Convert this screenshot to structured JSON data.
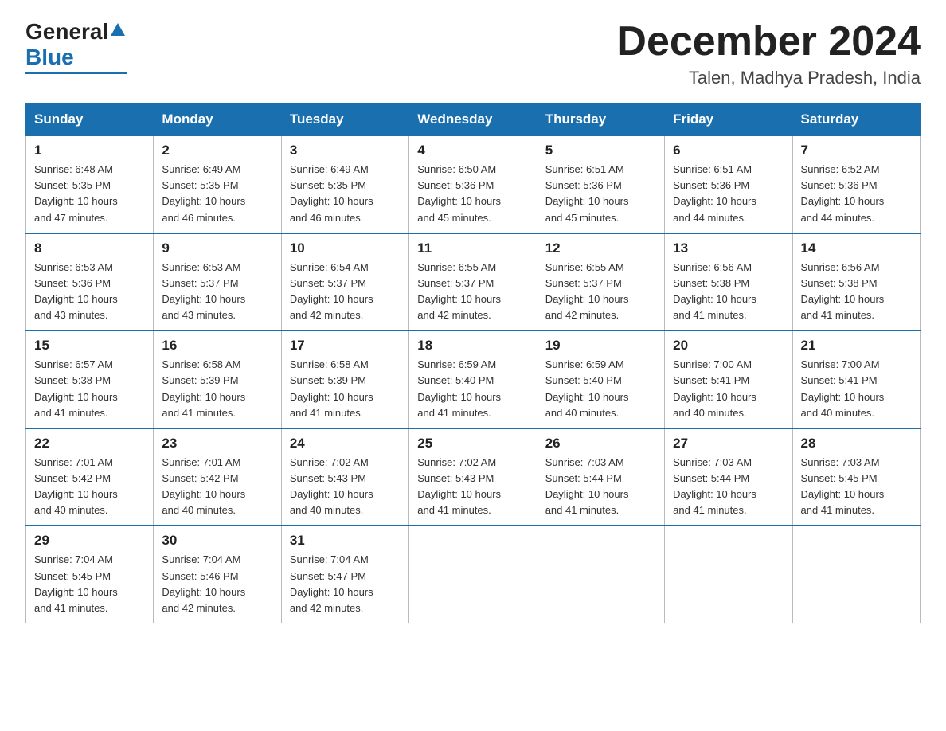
{
  "logo": {
    "general": "General",
    "blue": "Blue"
  },
  "header": {
    "title": "December 2024",
    "subtitle": "Talen, Madhya Pradesh, India"
  },
  "weekdays": [
    "Sunday",
    "Monday",
    "Tuesday",
    "Wednesday",
    "Thursday",
    "Friday",
    "Saturday"
  ],
  "weeks": [
    [
      {
        "day": "1",
        "sunrise": "6:48 AM",
        "sunset": "5:35 PM",
        "daylight": "10 hours and 47 minutes."
      },
      {
        "day": "2",
        "sunrise": "6:49 AM",
        "sunset": "5:35 PM",
        "daylight": "10 hours and 46 minutes."
      },
      {
        "day": "3",
        "sunrise": "6:49 AM",
        "sunset": "5:35 PM",
        "daylight": "10 hours and 46 minutes."
      },
      {
        "day": "4",
        "sunrise": "6:50 AM",
        "sunset": "5:36 PM",
        "daylight": "10 hours and 45 minutes."
      },
      {
        "day": "5",
        "sunrise": "6:51 AM",
        "sunset": "5:36 PM",
        "daylight": "10 hours and 45 minutes."
      },
      {
        "day": "6",
        "sunrise": "6:51 AM",
        "sunset": "5:36 PM",
        "daylight": "10 hours and 44 minutes."
      },
      {
        "day": "7",
        "sunrise": "6:52 AM",
        "sunset": "5:36 PM",
        "daylight": "10 hours and 44 minutes."
      }
    ],
    [
      {
        "day": "8",
        "sunrise": "6:53 AM",
        "sunset": "5:36 PM",
        "daylight": "10 hours and 43 minutes."
      },
      {
        "day": "9",
        "sunrise": "6:53 AM",
        "sunset": "5:37 PM",
        "daylight": "10 hours and 43 minutes."
      },
      {
        "day": "10",
        "sunrise": "6:54 AM",
        "sunset": "5:37 PM",
        "daylight": "10 hours and 42 minutes."
      },
      {
        "day": "11",
        "sunrise": "6:55 AM",
        "sunset": "5:37 PM",
        "daylight": "10 hours and 42 minutes."
      },
      {
        "day": "12",
        "sunrise": "6:55 AM",
        "sunset": "5:37 PM",
        "daylight": "10 hours and 42 minutes."
      },
      {
        "day": "13",
        "sunrise": "6:56 AM",
        "sunset": "5:38 PM",
        "daylight": "10 hours and 41 minutes."
      },
      {
        "day": "14",
        "sunrise": "6:56 AM",
        "sunset": "5:38 PM",
        "daylight": "10 hours and 41 minutes."
      }
    ],
    [
      {
        "day": "15",
        "sunrise": "6:57 AM",
        "sunset": "5:38 PM",
        "daylight": "10 hours and 41 minutes."
      },
      {
        "day": "16",
        "sunrise": "6:58 AM",
        "sunset": "5:39 PM",
        "daylight": "10 hours and 41 minutes."
      },
      {
        "day": "17",
        "sunrise": "6:58 AM",
        "sunset": "5:39 PM",
        "daylight": "10 hours and 41 minutes."
      },
      {
        "day": "18",
        "sunrise": "6:59 AM",
        "sunset": "5:40 PM",
        "daylight": "10 hours and 41 minutes."
      },
      {
        "day": "19",
        "sunrise": "6:59 AM",
        "sunset": "5:40 PM",
        "daylight": "10 hours and 40 minutes."
      },
      {
        "day": "20",
        "sunrise": "7:00 AM",
        "sunset": "5:41 PM",
        "daylight": "10 hours and 40 minutes."
      },
      {
        "day": "21",
        "sunrise": "7:00 AM",
        "sunset": "5:41 PM",
        "daylight": "10 hours and 40 minutes."
      }
    ],
    [
      {
        "day": "22",
        "sunrise": "7:01 AM",
        "sunset": "5:42 PM",
        "daylight": "10 hours and 40 minutes."
      },
      {
        "day": "23",
        "sunrise": "7:01 AM",
        "sunset": "5:42 PM",
        "daylight": "10 hours and 40 minutes."
      },
      {
        "day": "24",
        "sunrise": "7:02 AM",
        "sunset": "5:43 PM",
        "daylight": "10 hours and 40 minutes."
      },
      {
        "day": "25",
        "sunrise": "7:02 AM",
        "sunset": "5:43 PM",
        "daylight": "10 hours and 41 minutes."
      },
      {
        "day": "26",
        "sunrise": "7:03 AM",
        "sunset": "5:44 PM",
        "daylight": "10 hours and 41 minutes."
      },
      {
        "day": "27",
        "sunrise": "7:03 AM",
        "sunset": "5:44 PM",
        "daylight": "10 hours and 41 minutes."
      },
      {
        "day": "28",
        "sunrise": "7:03 AM",
        "sunset": "5:45 PM",
        "daylight": "10 hours and 41 minutes."
      }
    ],
    [
      {
        "day": "29",
        "sunrise": "7:04 AM",
        "sunset": "5:45 PM",
        "daylight": "10 hours and 41 minutes."
      },
      {
        "day": "30",
        "sunrise": "7:04 AM",
        "sunset": "5:46 PM",
        "daylight": "10 hours and 42 minutes."
      },
      {
        "day": "31",
        "sunrise": "7:04 AM",
        "sunset": "5:47 PM",
        "daylight": "10 hours and 42 minutes."
      },
      null,
      null,
      null,
      null
    ]
  ],
  "labels": {
    "sunrise": "Sunrise:",
    "sunset": "Sunset:",
    "daylight": "Daylight:"
  }
}
